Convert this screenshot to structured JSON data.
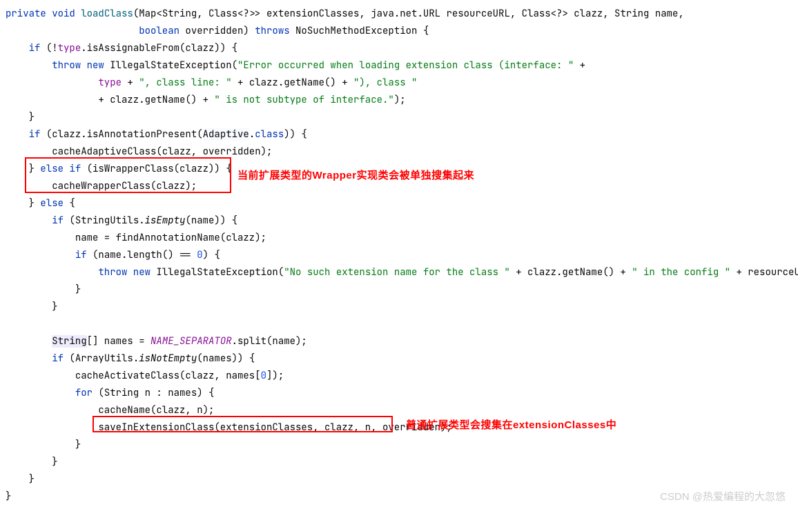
{
  "code": {
    "l1a": "private",
    "l1b": "void",
    "l1c": "loadClass",
    "l1d": "(Map<String, Class<?>> extensionClasses, java.net.URL resourceURL, Class<?> clazz, String name,",
    "l2a": "boolean",
    "l2b": " overridden) ",
    "l2c": "throws",
    "l2d": " NoSuchMethodException {",
    "l3a": "if",
    "l3b": " (!",
    "l3c": "type",
    "l3d": ".isAssignableFrom(clazz)) {",
    "l4a": "throw new",
    "l4b": " IllegalStateException(",
    "l4c": "\"Error occurred when loading extension class (interface: \"",
    "l4d": " +",
    "l5a": "type",
    "l5b": " + ",
    "l5c": "\", class line: \"",
    "l5d": " + clazz.getName() + ",
    "l5e": "\"), class \"",
    "l6a": "+ clazz.getName() + ",
    "l6b": "\" is not subtype of interface.\"",
    "l6c": ");",
    "l7": "}",
    "l8a": "if",
    "l8b": " (clazz.isAnnotationPresent(",
    "l8c": "Adaptive",
    "l8d": ".",
    "l8e": "class",
    "l8f": ")) {",
    "l9": "cacheAdaptiveClass(clazz, overridden);",
    "l10a": "} ",
    "l10b": "else if",
    "l10c": " (isWrapperClass(clazz)) {",
    "l11": "cacheWrapperClass(clazz);",
    "l12a": "} ",
    "l12b": "else",
    "l12c": " {",
    "l13a": "if",
    "l13b": " (StringUtils.",
    "l13c": "isEmpty",
    "l13d": "(name)) {",
    "l14": "name = findAnnotationName(clazz);",
    "l15a": "if",
    "l15b": " (name.length() == ",
    "l15c": "0",
    "l15d": ") {",
    "l16a": "throw new",
    "l16b": " IllegalStateException(",
    "l16c": "\"No such extension name for the class \"",
    "l16d": " + clazz.getName() + ",
    "l16e": "\" in the config \"",
    "l16f": " + resourceURL);",
    "l17": "}",
    "l18": "}",
    "l19a": "String",
    "l19b": "[] names = ",
    "l19c": "NAME_SEPARATOR",
    "l19d": ".split(name);",
    "l20a": "if",
    "l20b": " (ArrayUtils.",
    "l20c": "isNotEmpty",
    "l20d": "(names)) {",
    "l21a": "cacheActivateClass(clazz, names[",
    "l21b": "0",
    "l21c": "]);",
    "l22a": "for",
    "l22b": " (String n : names) {",
    "l23": "cacheName(clazz, n);",
    "l24": "saveInExtensionClass(extensionClasses, clazz, n, overridden);",
    "l25": "}",
    "l26": "}",
    "l27": "}",
    "l28": "}"
  },
  "annotations": {
    "a1": "当前扩展类型的Wrapper实现类会被单独搜集起来",
    "a2": "普通扩展类型会搜集在extensionClasses中"
  },
  "watermark": "CSDN @热爱编程的大忽悠"
}
